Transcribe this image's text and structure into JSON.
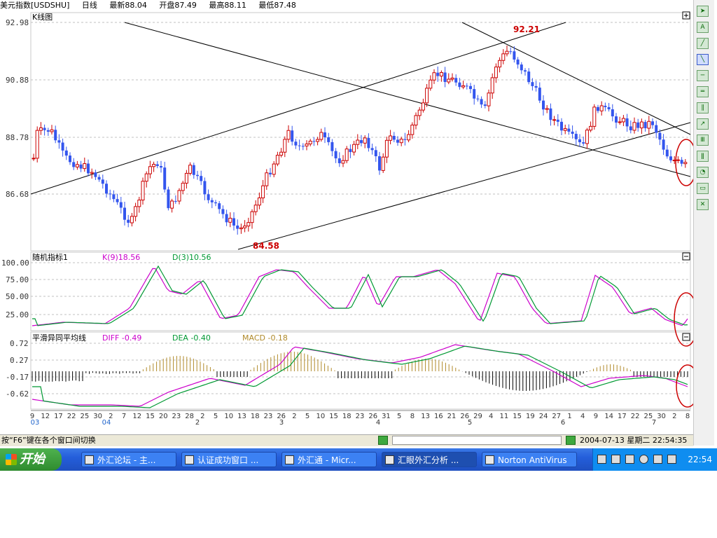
{
  "header": {
    "symbol": "美元指数[USDSHU]",
    "period": "日线",
    "latest": "最新88.04",
    "open": "开盘87.49",
    "high": "最高88.11",
    "low": "最低87.48"
  },
  "main_panel": {
    "title": "K线图",
    "y_ticks": [
      "92.98",
      "90.88",
      "88.78",
      "86.68"
    ],
    "y_values": [
      92.98,
      90.88,
      88.78,
      86.68
    ],
    "annotation_high": "92.21",
    "annotation_low": "84.58"
  },
  "kdj_panel": {
    "title": "随机指标1",
    "k_label": "K(9)18.56",
    "d_label": "D(3)10.56",
    "y_ticks": [
      "100.00",
      "75.00",
      "50.00",
      "25.00"
    ]
  },
  "macd_panel": {
    "title": "平滑异同平均线",
    "diff_label": "DIFF -0.49",
    "dea_label": "DEA -0.40",
    "macd_label": "MACD -0.18",
    "y_ticks": [
      "0.72",
      "0.27",
      "-0.17",
      "-0.62"
    ]
  },
  "x_axis": {
    "day_labels": [
      "9",
      "12",
      "17",
      "22",
      "25",
      "30",
      "2",
      "7",
      "12",
      "15",
      "20",
      "23",
      "28",
      "2",
      "5",
      "10",
      "13",
      "18",
      "23",
      "26",
      "2",
      "5",
      "10",
      "15",
      "18",
      "23",
      "26",
      "31",
      "5",
      "8",
      "13",
      "16",
      "21",
      "26",
      "29",
      "4",
      "11",
      "15",
      "19",
      "24",
      "27",
      "1",
      "4",
      "9",
      "14",
      "17",
      "22",
      "25",
      "30",
      "2",
      "8"
    ],
    "month_labels": [
      "03",
      "04",
      "2",
      "3",
      "4",
      "5",
      "6",
      "7"
    ]
  },
  "statusbar": {
    "hint": "按“F6”键在各个窗口间切换",
    "datetime": "2004-07-13 星期二 22:54:35"
  },
  "taskbar": {
    "start_label": "开始",
    "tasks": [
      "外汇论坛 - 主...",
      "认证成功窗口 ...",
      "外汇通 - Micr...",
      "汇眼外汇分析 ...",
      "Norton AntiVirus"
    ],
    "clock": "22:54"
  },
  "colors": {
    "up_candle": "#cc0000",
    "down_candle": "#3355ee",
    "k_line": "#cc00cc",
    "d_line": "#009933",
    "macd_positive": "#b08a2a",
    "macd_negative": "#000000",
    "grid": "#c0c0c0",
    "highlight_circle": "#cc0000"
  },
  "toolbar_icons": [
    "cursor-icon",
    "text-a-icon",
    "line-tool-icon",
    "ray-tool-icon",
    "segment-tool-icon",
    "channel-tool-icon",
    "parallel-tool-icon",
    "arrow-tool-icon",
    "fibonacci-tool-icon",
    "gann-tool-icon",
    "cycle-tool-icon",
    "rectangle-tool-icon",
    "delete-tool-icon"
  ]
}
